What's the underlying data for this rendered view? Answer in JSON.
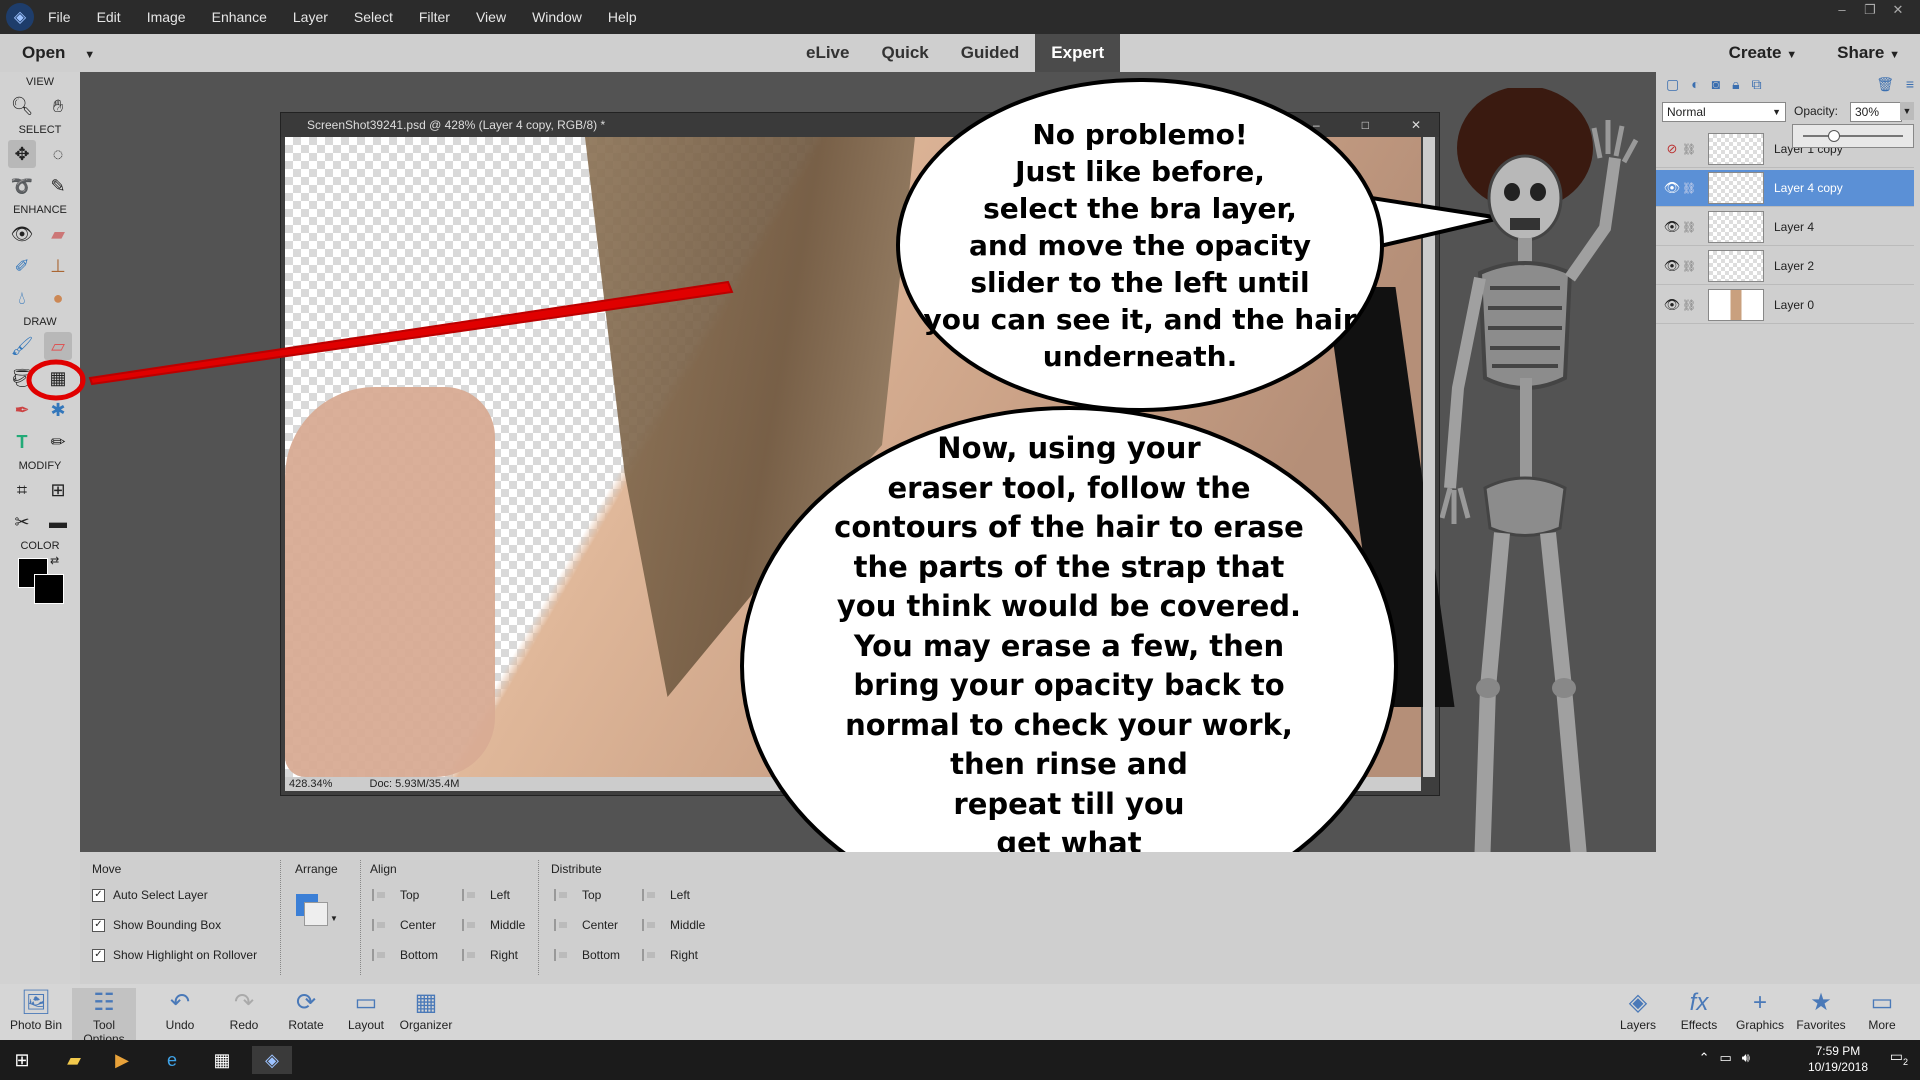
{
  "menubar": {
    "items": [
      "File",
      "Edit",
      "Image",
      "Enhance",
      "Layer",
      "Select",
      "Filter",
      "View",
      "Window",
      "Help"
    ]
  },
  "modebar": {
    "open": "Open",
    "modes": [
      "eLive",
      "Quick",
      "Guided",
      "Expert"
    ],
    "active_mode": "Expert",
    "create": "Create",
    "share": "Share"
  },
  "toolbox": {
    "sections": [
      "VIEW",
      "SELECT",
      "ENHANCE",
      "DRAW",
      "MODIFY",
      "COLOR"
    ]
  },
  "document": {
    "title": "ScreenShot39241.psd @ 428% (Layer 4 copy, RGB/8) *",
    "zoom": "428.34%",
    "doc_size": "Doc: 5.93M/35.4M"
  },
  "bubbles": {
    "top": "No problemo!\nJust like before,\nselect the bra layer,\nand move the opacity\nslider to the left until\nyou can see it, and the hair\nunderneath.",
    "bottom": "Now, using your\neraser tool, follow the\ncontours of the hair to erase\nthe parts of the strap that\nyou think would be covered.\nYou may erase a few, then\nbring your opacity back to\nnormal to check your work,\nthen rinse and\nrepeat till you\nget what\nyou want!"
  },
  "layers_panel": {
    "blend_mode": "Normal",
    "opacity_label": "Opacity:",
    "opacity_value": "30%",
    "opacity_fraction": 0.3,
    "layers": [
      {
        "name": "Layer 1 copy",
        "visible": false,
        "selected": false
      },
      {
        "name": "Layer 4 copy",
        "visible": true,
        "selected": true
      },
      {
        "name": "Layer 4",
        "visible": true,
        "selected": false
      },
      {
        "name": "Layer 2",
        "visible": true,
        "selected": false
      },
      {
        "name": "Layer 0",
        "visible": true,
        "selected": false
      }
    ]
  },
  "tool_options": {
    "move": "Move",
    "auto_select": "Auto Select Layer",
    "show_bounding": "Show Bounding Box",
    "show_highlight": "Show Highlight on Rollover",
    "arrange": "Arrange",
    "align": "Align",
    "align_items": [
      "Top",
      "Center",
      "Bottom",
      "Left",
      "Middle",
      "Right"
    ],
    "distribute": "Distribute",
    "distribute_items": [
      "Top",
      "Center",
      "Bottom",
      "Left",
      "Middle",
      "Right"
    ]
  },
  "bottombar": {
    "left": [
      "Photo Bin",
      "Tool Options",
      "Undo",
      "Redo",
      "Rotate",
      "Layout",
      "Organizer"
    ],
    "right": [
      "Layers",
      "Effects",
      "Graphics",
      "Favorites",
      "More"
    ]
  },
  "taskbar": {
    "time": "7:59 PM",
    "date": "10/19/2018",
    "notifications": "2"
  },
  "colors": {
    "accent": "#5b90d6",
    "annotation_red": "#e00000"
  }
}
